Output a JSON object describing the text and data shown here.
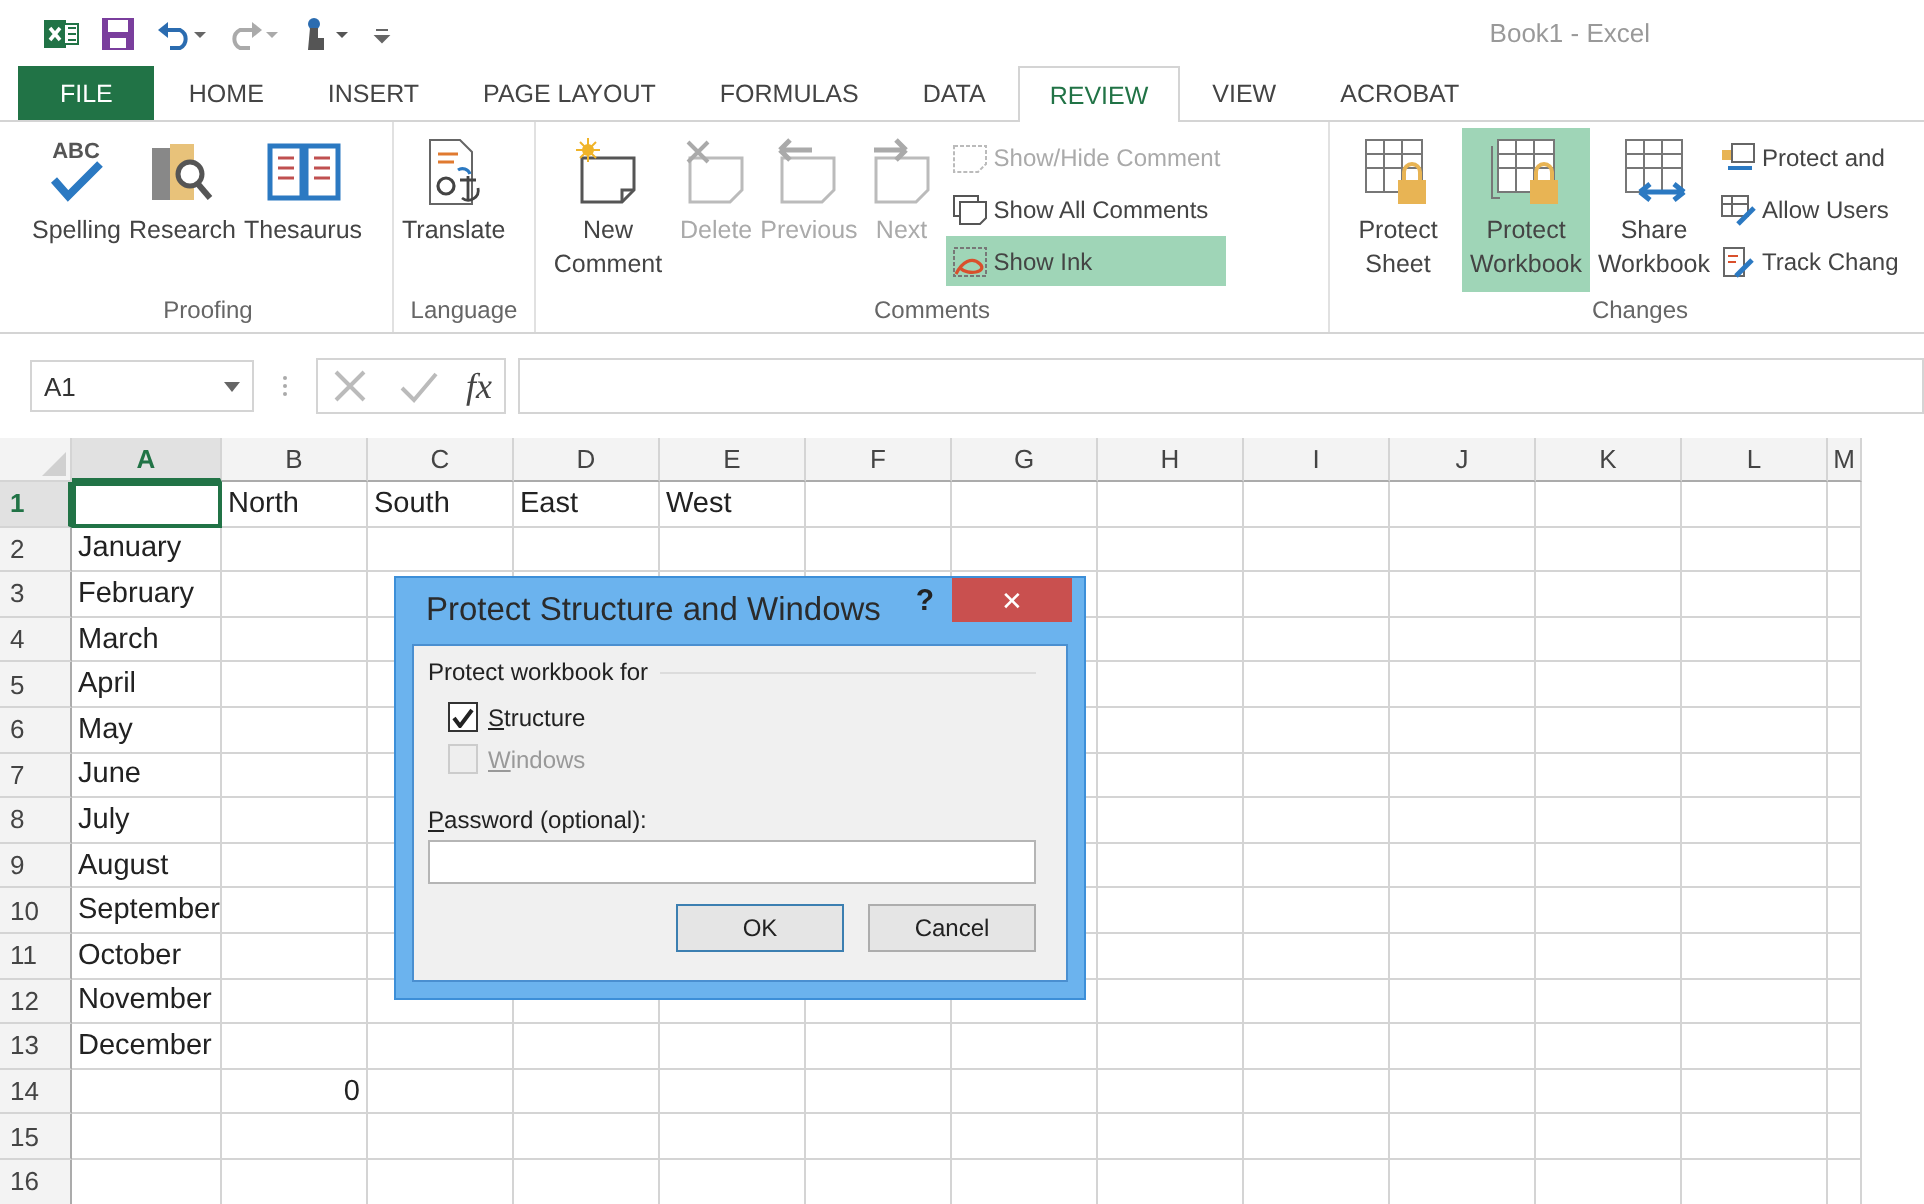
{
  "window": {
    "title": "Book1 - Excel"
  },
  "tabs": [
    {
      "label": "FILE",
      "kind": "file",
      "selected": false
    },
    {
      "label": "HOME",
      "kind": "tab",
      "selected": false
    },
    {
      "label": "INSERT",
      "kind": "tab",
      "selected": false
    },
    {
      "label": "PAGE LAYOUT",
      "kind": "tab",
      "selected": false
    },
    {
      "label": "FORMULAS",
      "kind": "tab",
      "selected": false
    },
    {
      "label": "DATA",
      "kind": "tab",
      "selected": false
    },
    {
      "label": "REVIEW",
      "kind": "tab",
      "selected": true
    },
    {
      "label": "VIEW",
      "kind": "tab",
      "selected": false
    },
    {
      "label": "ACROBAT",
      "kind": "tab",
      "selected": false
    }
  ],
  "ribbon": {
    "groups": [
      {
        "label": "Proofing",
        "buttons": [
          {
            "label": "Spelling",
            "kind": "large",
            "icon_text": "ABC",
            "disabled": false,
            "selected": false
          },
          {
            "label": "Research",
            "kind": "large",
            "disabled": false,
            "selected": false
          },
          {
            "label": "Thesaurus",
            "kind": "large",
            "disabled": false,
            "selected": false
          }
        ]
      },
      {
        "label": "Language",
        "buttons": [
          {
            "label": "Translate",
            "kind": "large",
            "disabled": false,
            "selected": false
          }
        ]
      },
      {
        "label": "Comments",
        "buttons": [
          {
            "label": "New Comment",
            "kind": "large",
            "disabled": false,
            "selected": false
          },
          {
            "label": "Delete",
            "kind": "large",
            "disabled": true,
            "selected": false
          },
          {
            "label": "Previous",
            "kind": "large",
            "disabled": true,
            "selected": false
          },
          {
            "label": "Next",
            "kind": "large",
            "disabled": true,
            "selected": false
          },
          {
            "label": "Show/Hide Comment",
            "kind": "small",
            "disabled": true,
            "selected": false
          },
          {
            "label": "Show All Comments",
            "kind": "small",
            "disabled": false,
            "selected": false
          },
          {
            "label": "Show Ink",
            "kind": "small",
            "disabled": false,
            "selected": true
          }
        ]
      },
      {
        "label": "Changes",
        "buttons": [
          {
            "label": "Protect Sheet",
            "kind": "large",
            "disabled": false,
            "selected": false
          },
          {
            "label": "Protect Workbook",
            "kind": "large",
            "disabled": false,
            "selected": true
          },
          {
            "label": "Share Workbook",
            "kind": "large",
            "disabled": false,
            "selected": false
          },
          {
            "label": "Protect and",
            "kind": "small",
            "disabled": false,
            "selected": false
          },
          {
            "label": "Allow Users",
            "kind": "small",
            "disabled": false,
            "selected": false
          },
          {
            "label": "Track Chang",
            "kind": "small",
            "disabled": false,
            "selected": false
          }
        ]
      }
    ]
  },
  "formula_bar": {
    "name_box": "A1",
    "function_label": "fx"
  },
  "sheet": {
    "columns": [
      {
        "label": "A",
        "selected": true
      },
      {
        "label": "B",
        "selected": false
      },
      {
        "label": "C",
        "selected": false
      },
      {
        "label": "D",
        "selected": false
      },
      {
        "label": "E",
        "selected": false
      },
      {
        "label": "F",
        "selected": false
      },
      {
        "label": "G",
        "selected": false
      },
      {
        "label": "H",
        "selected": false
      },
      {
        "label": "I",
        "selected": false
      },
      {
        "label": "J",
        "selected": false
      },
      {
        "label": "K",
        "selected": false
      },
      {
        "label": "L",
        "selected": false
      },
      {
        "label": "M",
        "selected": false
      }
    ],
    "rows": [
      {
        "number": "1",
        "selected": true,
        "cells": [
          {
            "text": ""
          },
          {
            "text": "North"
          },
          {
            "text": "South"
          },
          {
            "text": "East"
          },
          {
            "text": "West"
          }
        ]
      },
      {
        "number": "2",
        "selected": false,
        "cells": [
          {
            "text": "January"
          }
        ]
      },
      {
        "number": "3",
        "selected": false,
        "cells": [
          {
            "text": "February"
          }
        ]
      },
      {
        "number": "4",
        "selected": false,
        "cells": [
          {
            "text": "March"
          }
        ]
      },
      {
        "number": "5",
        "selected": false,
        "cells": [
          {
            "text": "April"
          }
        ]
      },
      {
        "number": "6",
        "selected": false,
        "cells": [
          {
            "text": "May"
          }
        ]
      },
      {
        "number": "7",
        "selected": false,
        "cells": [
          {
            "text": "June"
          }
        ]
      },
      {
        "number": "8",
        "selected": false,
        "cells": [
          {
            "text": "July"
          }
        ]
      },
      {
        "number": "9",
        "selected": false,
        "cells": [
          {
            "text": "August"
          }
        ]
      },
      {
        "number": "10",
        "selected": false,
        "cells": [
          {
            "text": "September"
          }
        ]
      },
      {
        "number": "11",
        "selected": false,
        "cells": [
          {
            "text": "October"
          }
        ]
      },
      {
        "number": "12",
        "selected": false,
        "cells": [
          {
            "text": "November"
          }
        ]
      },
      {
        "number": "13",
        "selected": false,
        "cells": [
          {
            "text": "December"
          }
        ]
      },
      {
        "number": "14",
        "selected": false,
        "cells": [
          {
            "text": ""
          },
          {
            "text": "0",
            "kind": "number"
          }
        ]
      },
      {
        "number": "15",
        "selected": false,
        "cells": []
      },
      {
        "number": "16",
        "selected": false,
        "cells": []
      }
    ]
  },
  "dialog": {
    "title": "Protect Structure and Windows",
    "help": "?",
    "close": "✕",
    "group_label": "Protect workbook for",
    "options": [
      {
        "label": "Structure",
        "checked": true,
        "disabled": false
      },
      {
        "label": "Windows",
        "checked": false,
        "disabled": true
      }
    ],
    "password_label": "Password (optional):",
    "buttons": [
      {
        "label": "OK",
        "default": true
      },
      {
        "label": "Cancel",
        "default": false
      }
    ]
  }
}
